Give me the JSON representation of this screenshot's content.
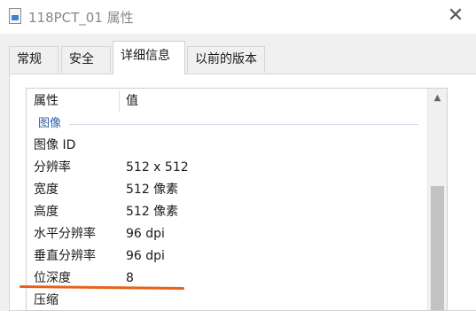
{
  "window": {
    "title": "118PCT_01 属性",
    "icon": "image-file-icon",
    "close_symbol": "✕"
  },
  "tabs": [
    {
      "label": "常规",
      "active": false
    },
    {
      "label": "安全",
      "active": false
    },
    {
      "label": "详细信息",
      "active": true
    },
    {
      "label": "以前的版本",
      "active": false
    }
  ],
  "details": {
    "columns": {
      "property": "属性",
      "value": "值"
    },
    "group": "图像",
    "rows": [
      {
        "property": "图像 ID",
        "value": ""
      },
      {
        "property": "分辨率",
        "value": "512 x 512"
      },
      {
        "property": "宽度",
        "value": "512 像素"
      },
      {
        "property": "高度",
        "value": "512 像素"
      },
      {
        "property": "水平分辨率",
        "value": "96 dpi"
      },
      {
        "property": "垂直分辨率",
        "value": "96 dpi"
      },
      {
        "property": "位深度",
        "value": "8"
      },
      {
        "property": "压缩",
        "value": ""
      }
    ]
  },
  "scrollbar": {
    "up_symbol": "▲"
  },
  "colors": {
    "annotation": "#e8601c",
    "group_label": "#2f5fa8",
    "dialog_bg": "#f0f0f0"
  }
}
